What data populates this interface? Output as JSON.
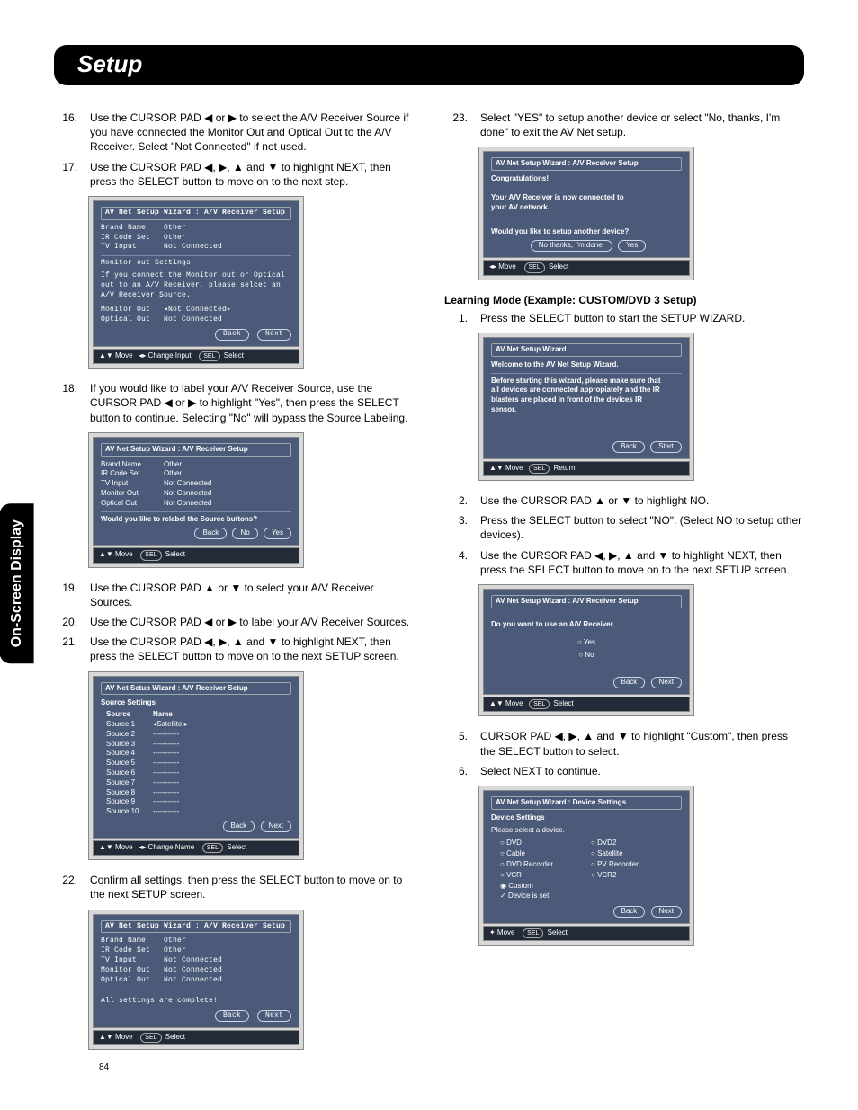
{
  "page_title": "Setup",
  "side_tab": "On-Screen Display",
  "page_number": "84",
  "left": {
    "steps": [
      {
        "n": "16.",
        "t": "Use the CURSOR PAD ◀ or ▶ to select the A/V Receiver Source if you have connected the Monitor Out and Optical Out to the A/V Receiver.  Select \"Not Connected\" if not used."
      },
      {
        "n": "17.",
        "t": "Use the CURSOR PAD ◀, ▶, ▲ and ▼ to highlight NEXT, then press the SELECT button to move on to the next step."
      }
    ],
    "osd1": {
      "title": "AV Net Setup Wizard : A/V Receiver Setup",
      "rows": [
        [
          "Brand Name",
          "Other"
        ],
        [
          "IR Code Set",
          "Other"
        ],
        [
          "TV Input",
          "Not Connected"
        ]
      ],
      "msg_head": "Monitor out Settings",
      "msg_body": "If you connect the Monitor out or Optical out to an A/V Receiver, please selcet an A/V Receiver Source.",
      "rows2": [
        [
          "Monitor Out",
          "◂Not Connected▸"
        ],
        [
          "Optical Out",
          "Not Connected"
        ]
      ],
      "btns": [
        "Back",
        "Next"
      ],
      "foot": [
        "▲▼ Move",
        "◂▸ Change Input",
        "SEL",
        "Select"
      ]
    },
    "steps2": [
      {
        "n": "18.",
        "t": "If you would like to label your A/V Receiver Source, use the CURSOR PAD ◀ or ▶ to highlight \"Yes\", then press the SELECT button to continue.  Selecting \"No\" will bypass the Source Labeling."
      }
    ],
    "osd2": {
      "title": "AV Net Setup Wizard : A/V Receiver Setup",
      "rows": [
        [
          "Brand Name",
          "Other"
        ],
        [
          "IR Code Set",
          "Other"
        ],
        [
          "TV Input",
          "Not Connected"
        ],
        [
          "Monitor Out",
          "Not Connected"
        ],
        [
          "Optical Out",
          "Not Connected"
        ]
      ],
      "question": "Would you like to relabel the Source buttons?",
      "btns": [
        "Back",
        "No",
        "Yes"
      ],
      "foot": [
        "▲▼ Move",
        "SEL",
        "Select"
      ]
    },
    "steps3": [
      {
        "n": "19.",
        "t": "Use the CURSOR PAD ▲ or ▼ to select your A/V Receiver Sources."
      },
      {
        "n": "20.",
        "t": "Use the CURSOR PAD ◀ or ▶ to label your A/V Receiver Sources."
      },
      {
        "n": "21.",
        "t": "Use the CURSOR PAD ◀, ▶, ▲ and ▼ to highlight NEXT, then press the SELECT button to move on to the next SETUP screen."
      }
    ],
    "osd3": {
      "title": "AV Net Setup Wizard : A/V Receiver Setup",
      "sub": "Source Settings",
      "head": [
        "Source",
        "Name"
      ],
      "rows": [
        [
          "Source 1",
          "◂Satellite   ▸"
        ],
        [
          "Source 2",
          "-----------"
        ],
        [
          "Source 3",
          "-----------"
        ],
        [
          "Source 4",
          "-----------"
        ],
        [
          "Source 5",
          "-----------"
        ],
        [
          "Source 6",
          "-----------"
        ],
        [
          "Source 7",
          "-----------"
        ],
        [
          "Source 8",
          "-----------"
        ],
        [
          "Source 9",
          "-----------"
        ],
        [
          "Source 10",
          "-----------"
        ]
      ],
      "btns": [
        "Back",
        "Next"
      ],
      "foot": [
        "▲▼ Move",
        "◂▸ Change Name",
        "SEL",
        "Select"
      ]
    },
    "steps4": [
      {
        "n": "22.",
        "t": "Confirm all settings, then press the SELECT button to move on to the next SETUP screen."
      }
    ],
    "osd4": {
      "title": "AV Net Setup Wizard : A/V Receiver Setup",
      "rows": [
        [
          "Brand Name",
          "Other"
        ],
        [
          "IR Code Set",
          "Other"
        ],
        [
          "TV Input",
          "Not Connected"
        ],
        [
          "Monitor Out",
          "Not Connected"
        ],
        [
          "Optical Out",
          "Not Connected"
        ]
      ],
      "msg": "All settings are complete!",
      "btns": [
        "Back",
        "Next"
      ],
      "foot": [
        "▲▼ Move",
        "SEL",
        "Select"
      ]
    }
  },
  "right": {
    "steps": [
      {
        "n": "23.",
        "t": "Select \"YES\" to setup another device or select \"No, thanks, I'm done\" to exit the AV Net setup."
      }
    ],
    "osd5": {
      "title": "AV Net Setup Wizard : A/V Receiver Setup",
      "l1": "Congratulations!",
      "l2": "Your A/V Receiver is now connected to your AV network.",
      "q": "Would you like to setup another device?",
      "btns": [
        "No thanks, I'm done.",
        "Yes"
      ],
      "foot": [
        "◂▸ Move",
        "SEL",
        "Select"
      ]
    },
    "heading": "Learning Mode (Example:  CUSTOM/DVD 3 Setup)",
    "stepsB": [
      {
        "n": "1.",
        "t": "Press the SELECT button to start the SETUP WIZARD."
      }
    ],
    "osd6": {
      "title": "AV Net Setup Wizard",
      "sub": "Welcome to the AV Net Setup Wizard.",
      "msg": "Before starting this wizard, please make sure that all devices are connected appropiately and the IR blasters are placed in front of the devices IR sensor.",
      "btns": [
        "Back",
        "Start"
      ],
      "foot": [
        "▲▼ Move",
        "SEL",
        "Return"
      ]
    },
    "stepsC": [
      {
        "n": "2.",
        "t": "Use the CURSOR PAD ▲ or ▼ to highlight NO."
      },
      {
        "n": "3.",
        "t": "Press the SELECT button to select \"NO\". (Select NO to setup other devices)."
      },
      {
        "n": "4.",
        "t": "Use the CURSOR PAD ◀, ▶, ▲ and ▼ to highlight NEXT, then press the SELECT button to move on to the next SETUP screen."
      }
    ],
    "osd7": {
      "title": "AV Net Setup Wizard : A/V Receiver Setup",
      "q": "Do you want to use an A/V Receiver.",
      "opts": [
        "Yes",
        "No"
      ],
      "btns": [
        "Back",
        "Next"
      ],
      "foot": [
        "▲▼ Move",
        "SEL",
        "Select"
      ]
    },
    "stepsD": [
      {
        "n": "5.",
        "t": "CURSOR PAD ◀, ▶, ▲ and ▼ to highlight \"Custom\", then press the SELECT button to select."
      },
      {
        "n": "6.",
        "t": "Select NEXT to continue."
      }
    ],
    "osd8": {
      "title": "AV Net Setup Wizard : Device Settings",
      "sub": "Device Settings",
      "msg": "Please select a device.",
      "left": [
        "DVD",
        "Cable",
        "DVD Recorder",
        "VCR"
      ],
      "right": [
        "DVD2",
        "Satellite",
        "PV Recorder",
        "VCR2"
      ],
      "sel": "Custom",
      "set": "Device is set.",
      "btns": [
        "Back",
        "Next"
      ],
      "foot": [
        "✦ Move",
        "SEL",
        "Select"
      ]
    }
  }
}
